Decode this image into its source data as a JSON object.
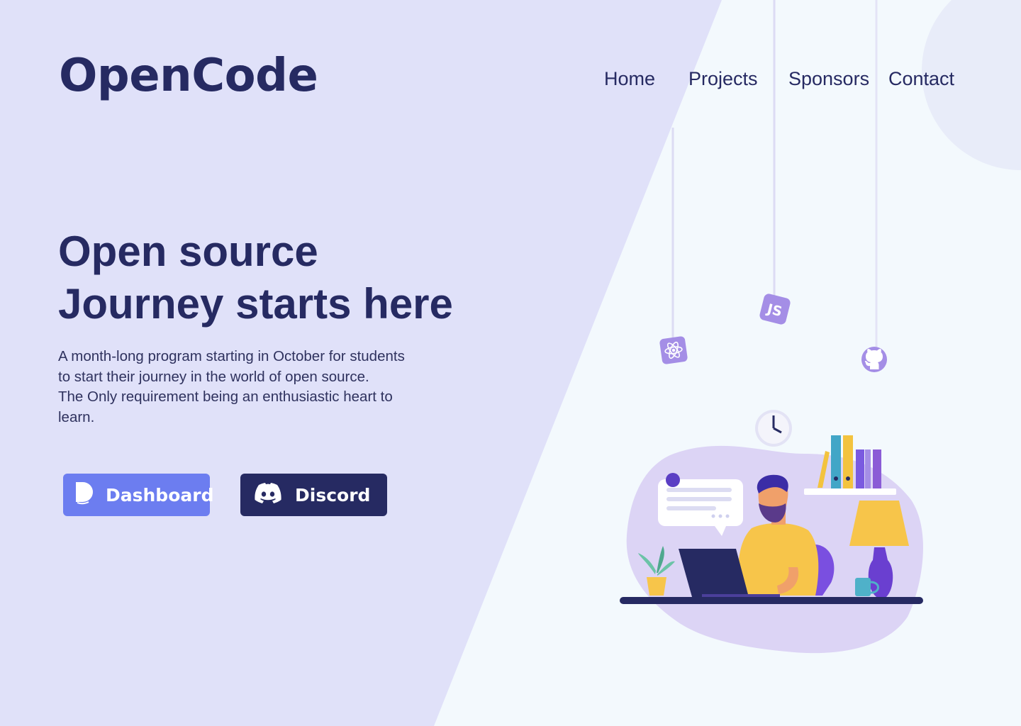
{
  "brand": {
    "logo_text": "OpenCode"
  },
  "nav": {
    "items": [
      {
        "label": "Home"
      },
      {
        "label": "Projects"
      },
      {
        "label": "Sponsors"
      },
      {
        "label": "Contact"
      }
    ]
  },
  "hero": {
    "title_line1": "Open source",
    "title_line2": "Journey starts here",
    "description_lines": [
      "A month-long program starting in October for students",
      "to start their journey in the world of open source.",
      "The Only requirement being an enthusiastic heart to",
      "learn."
    ]
  },
  "buttons": {
    "dashboard_label": "Dashboard",
    "discord_label": "Discord"
  },
  "hanging_icons": {
    "react": "react-icon",
    "javascript_text": "JS",
    "github": "github-icon"
  },
  "colors": {
    "left_panel": "#e0e1f9",
    "right_panel": "#f3f9fd",
    "text_dark": "#262a62",
    "dashboard_button": "#6c7df0",
    "discord_button": "#262a62",
    "icon_purple": "#a48ee6"
  }
}
